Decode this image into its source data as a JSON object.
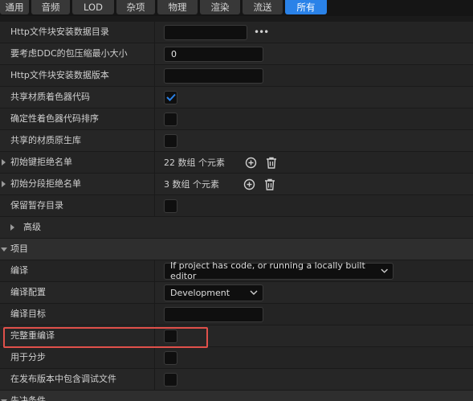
{
  "tabs": [
    {
      "label": "通用",
      "active": false
    },
    {
      "label": "音频",
      "active": false
    },
    {
      "label": "LOD",
      "active": false
    },
    {
      "label": "杂项",
      "active": false
    },
    {
      "label": "物理",
      "active": false
    },
    {
      "label": "渲染",
      "active": false
    },
    {
      "label": "流送",
      "active": false
    },
    {
      "label": "所有",
      "active": true
    }
  ],
  "rows": {
    "http_dir": {
      "label": "Http文件块安装数据目录",
      "value": "",
      "browse": "•••"
    },
    "ddc_min_size": {
      "label": "要考虑DDC的包压缩最小大小",
      "value": "0"
    },
    "http_version": {
      "label": "Http文件块安装数据版本",
      "value": ""
    },
    "share_shader": {
      "label": "共享材质着色器代码",
      "checked": true
    },
    "deterministic_shader": {
      "label": "确定性着色器代码排序",
      "checked": false
    },
    "shared_material_lib": {
      "label": "共享的材质原生库",
      "checked": false
    },
    "init_key_denylist": {
      "label": "初始键拒绝名单",
      "count": "22 数组 个元素"
    },
    "init_chunk_denylist": {
      "label": "初始分段拒绝名单",
      "count": "3 数组 个元素"
    },
    "keep_temp_dir": {
      "label": "保留暂存目录",
      "checked": false
    },
    "advanced": {
      "label": "高级"
    }
  },
  "section_project": {
    "label": "项目"
  },
  "project_rows": {
    "build": {
      "label": "编译",
      "value": "If project has code, or running a locally built editor"
    },
    "build_config": {
      "label": "编译配置",
      "value": "Development"
    },
    "build_target": {
      "label": "编译目标",
      "value": ""
    },
    "full_rebuild": {
      "label": "完整重编译",
      "checked": false
    },
    "for_distribution": {
      "label": "用于分步",
      "checked": false
    },
    "include_debug_files": {
      "label": "在发布版本中包含调试文件",
      "checked": false
    }
  },
  "section_prereq": {
    "label": "先决条件"
  },
  "colors": {
    "accent": "#2a82e8",
    "highlight": "#e0504a"
  }
}
